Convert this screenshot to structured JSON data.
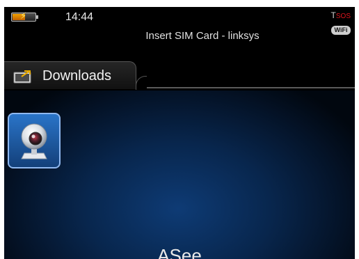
{
  "status_bar": {
    "time": "14:44",
    "network_status": "Insert SIM Card - linksys",
    "signal_label": "T",
    "sos_label": "SOS",
    "wifi_label": "WiFi",
    "battery_level": 0.55,
    "battery_icon": "battery-charging-icon"
  },
  "tab": {
    "label": "Downloads",
    "icon": "folder-icon"
  },
  "apps": [
    {
      "icon": "webcam-icon",
      "name": "ASee"
    }
  ],
  "colors": {
    "background_blue": "#0e3b75",
    "tile_border": "#8fb8f0",
    "sos_red": "#e0141c"
  }
}
